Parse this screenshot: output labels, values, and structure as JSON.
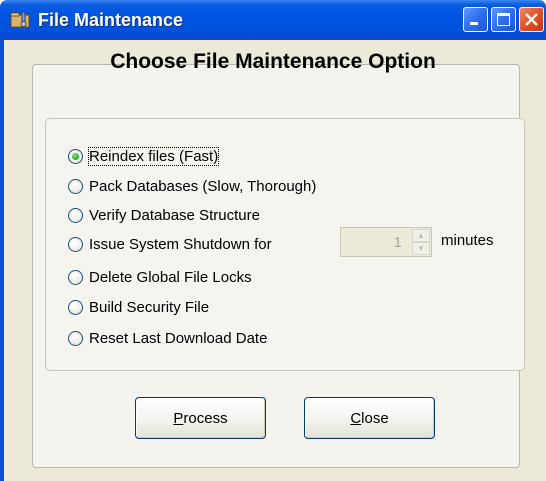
{
  "window": {
    "title": "File Maintenance",
    "title_icon": "folder-tools-icon",
    "controls": {
      "minimize": "minimize-icon",
      "maximize": "maximize-icon",
      "close": "close-icon"
    },
    "accent": "#0054e3"
  },
  "heading": "Choose File Maintenance Option",
  "options": [
    {
      "label": "Reindex files (Fast)",
      "checked": true
    },
    {
      "label": "Pack Databases (Slow, Thorough)",
      "checked": false
    },
    {
      "label": "Verify Database Structure",
      "checked": false
    },
    {
      "label": "Issue System Shutdown for",
      "checked": false
    },
    {
      "label": "Delete Global File Locks",
      "checked": false
    },
    {
      "label": "Build Security File",
      "checked": false
    },
    {
      "label": "Reset Last Download Date",
      "checked": false
    }
  ],
  "shutdown": {
    "value": "1",
    "unit_label": "minutes",
    "enabled": false
  },
  "buttons": {
    "process": {
      "mnemonic": "P",
      "rest": "rocess"
    },
    "close": {
      "mnemonic": "C",
      "rest": "lose"
    }
  }
}
